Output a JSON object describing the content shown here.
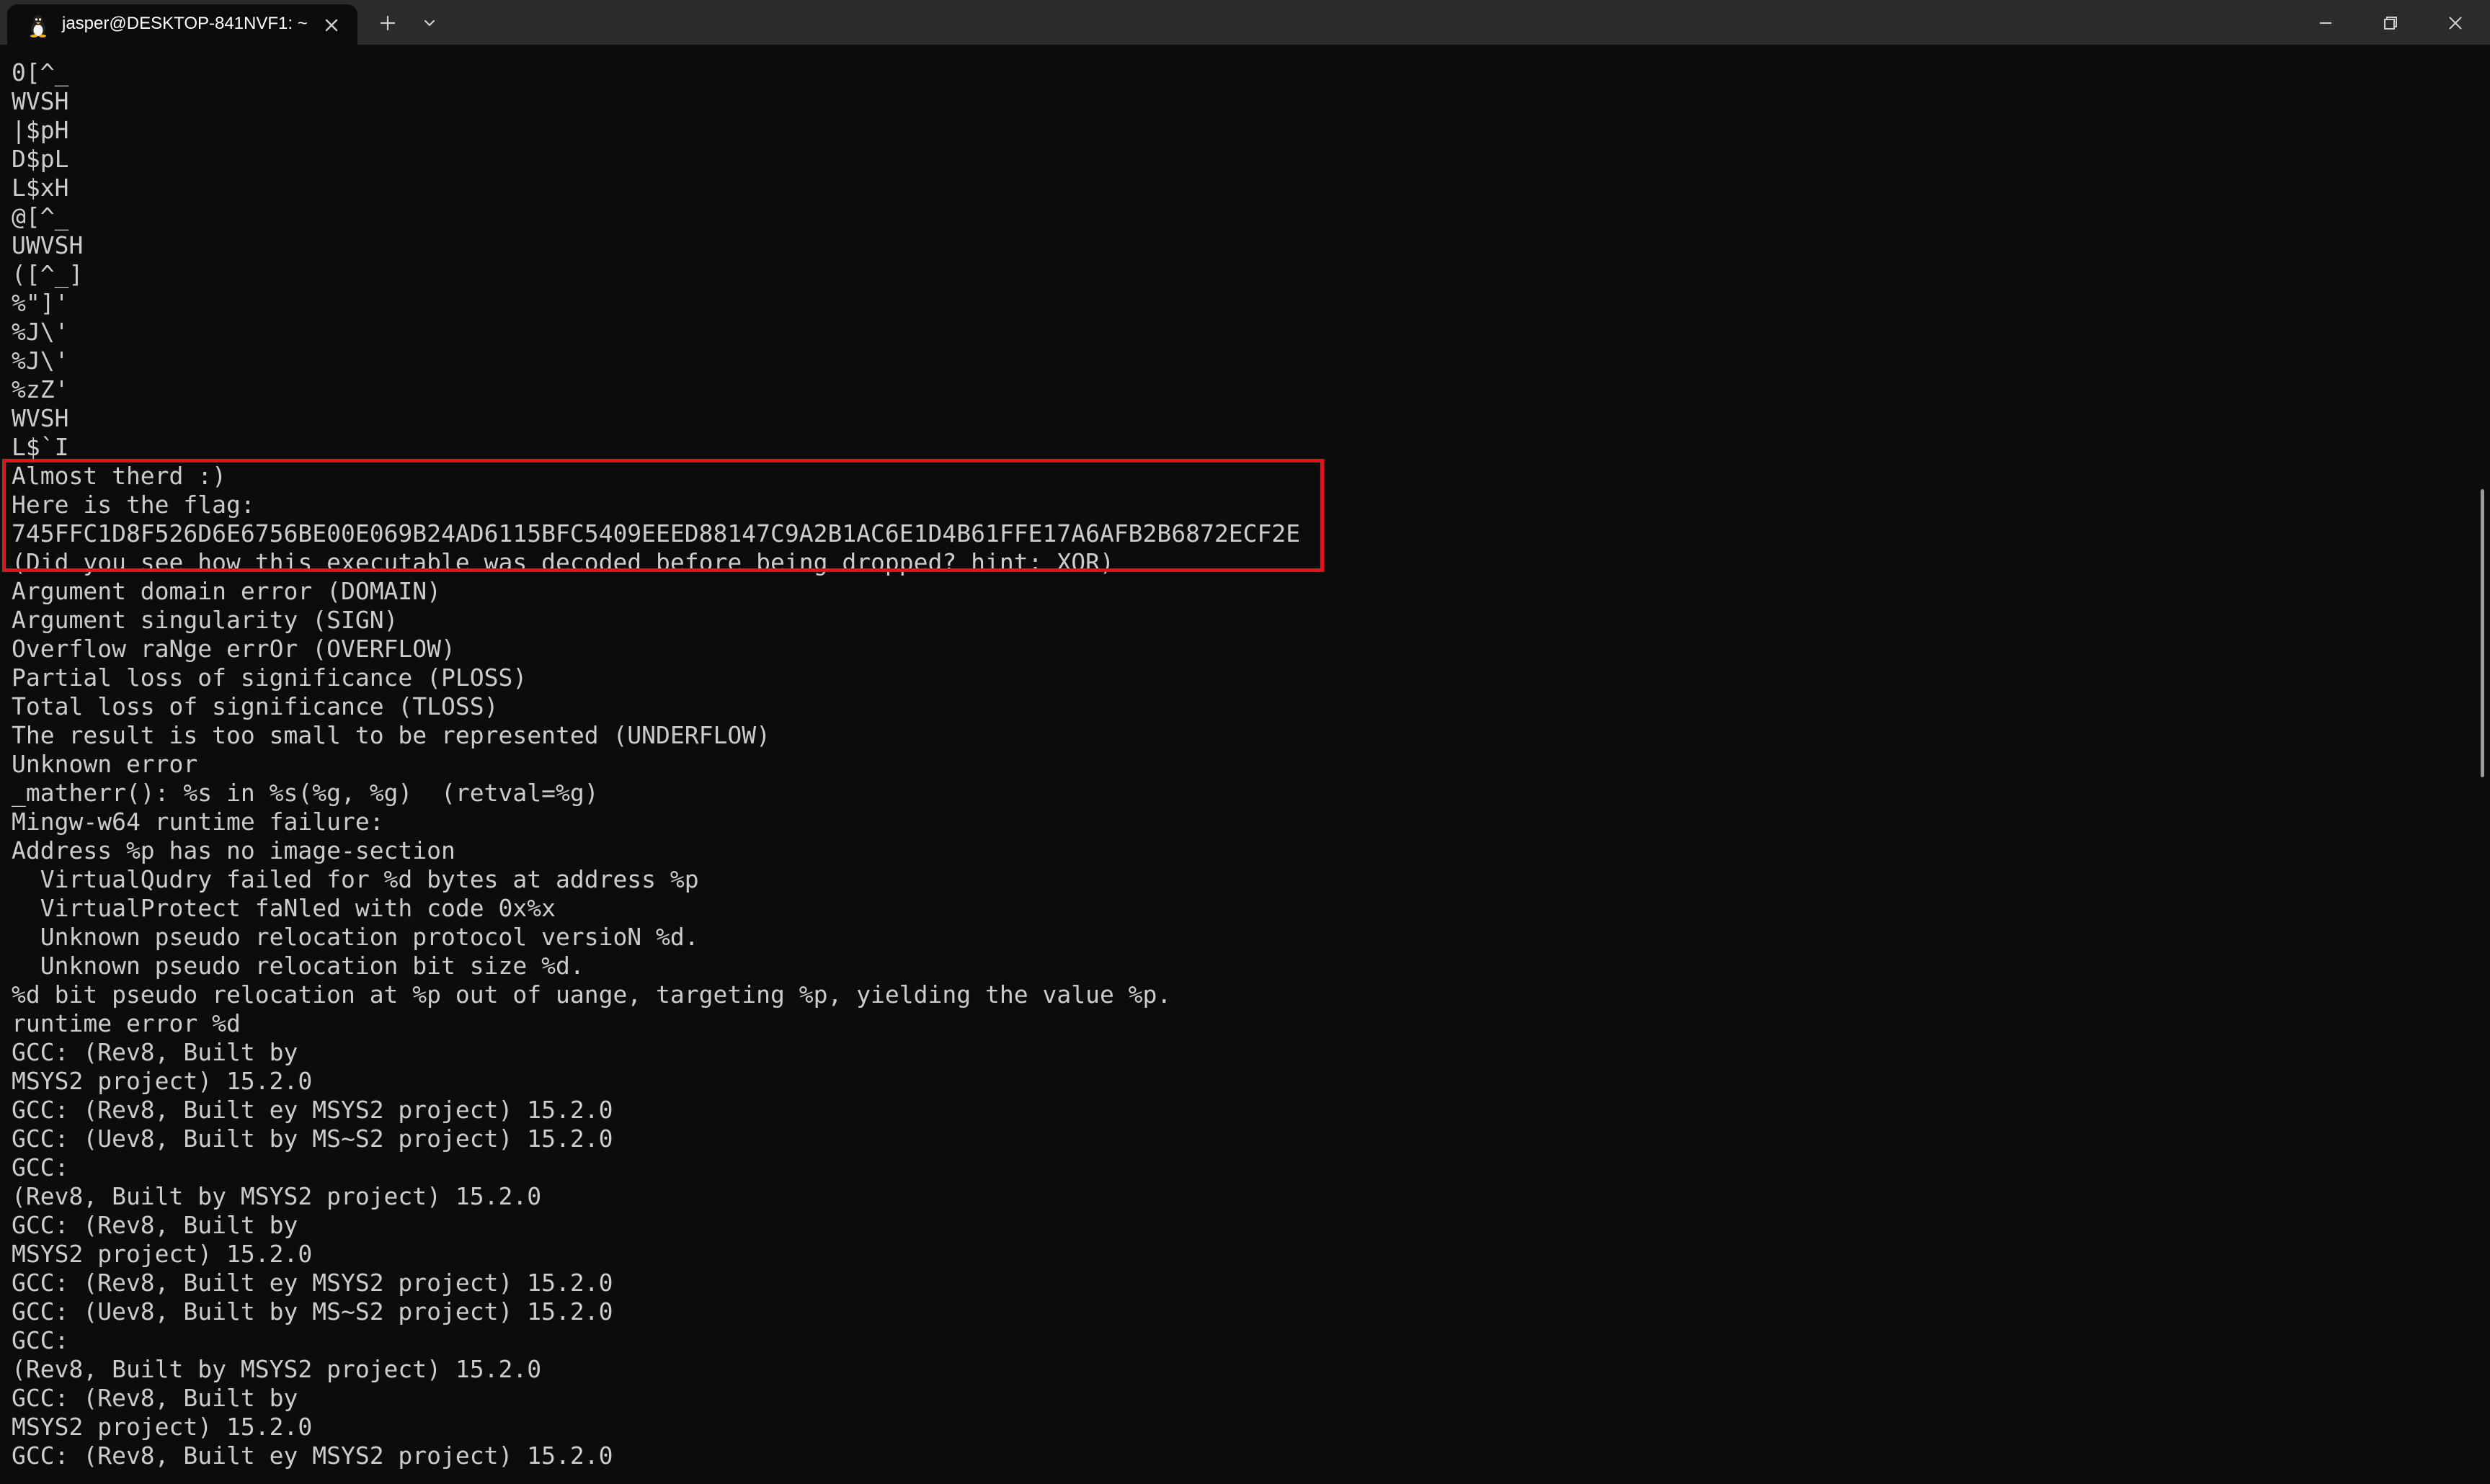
{
  "window": {
    "tab_title": "jasper@DESKTOP-841NVF1: ~",
    "tab_icon": "linux-penguin-icon",
    "controls": [
      "minimize-icon",
      "maximize-icon",
      "close-icon"
    ]
  },
  "terminal": {
    "lines": [
      "0[^_",
      "WVSH",
      "|$pH",
      "D$pL",
      "L$xH",
      "@[^_",
      "UWVSH",
      "([^_]",
      "%\"]'",
      "%J\\'",
      "%J\\'",
      "%zZ'",
      "WVSH",
      "L$`I",
      "Almost therd :)",
      "Here is the flag:",
      "745FFC1D8F526D6E6756BE00E069B24AD6115BFC5409EEED88147C9A2B1AC6E1D4B61FFE17A6AFB2B6872ECF2E",
      "(Did you see how this executable was decoded before being dropped? hint: XOR)",
      "Argument domain error (DOMAIN)",
      "Argument singularity (SIGN)",
      "Overflow raNge errOr (OVERFLOW)",
      "Partial loss of significance (PLOSS)",
      "Total loss of significance (TLOSS)",
      "The result is too small to be represented (UNDERFLOW)",
      "Unknown error",
      "_matherr(): %s in %s(%g, %g)  (retval=%g)",
      "Mingw-w64 runtime failure:",
      "Address %p has no image-section",
      "  VirtualQudry failed for %d bytes at address %p",
      "  VirtualProtect faNled with code 0x%x",
      "  Unknown pseudo relocation protocol versioN %d.",
      "  Unknown pseudo relocation bit size %d.",
      "%d bit pseudo relocation at %p out of uange, targeting %p, yielding the value %p.",
      "runtime error %d",
      "GCC: (Rev8, Built by",
      "MSYS2 project) 15.2.0",
      "GCC: (Rev8, Built ey MSYS2 project) 15.2.0",
      "GCC: (Uev8, Built by MS~S2 project) 15.2.0",
      "GCC:",
      "(Rev8, Built by MSYS2 project) 15.2.0",
      "GCC: (Rev8, Built by",
      "MSYS2 project) 15.2.0",
      "GCC: (Rev8, Built ey MSYS2 project) 15.2.0",
      "GCC: (Uev8, Built by MS~S2 project) 15.2.0",
      "GCC:",
      "(Rev8, Built by MSYS2 project) 15.2.0",
      "GCC: (Rev8, Built by",
      "MSYS2 project) 15.2.0",
      "GCC: (Rev8, Built ey MSYS2 project) 15.2.0"
    ]
  },
  "colors": {
    "background": "#0c0c0c",
    "text": "#cccccc",
    "titlebar": "#2b2b2b",
    "highlight": "#e0141e"
  }
}
